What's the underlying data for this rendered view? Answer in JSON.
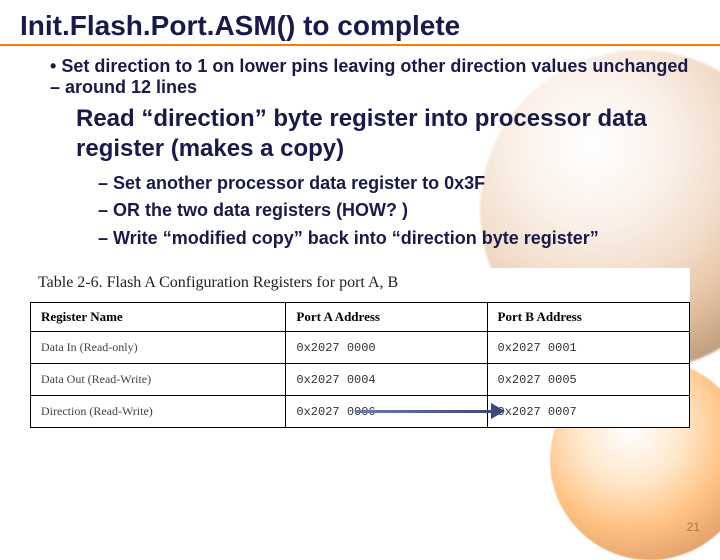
{
  "title": "Init.Flash.Port.ASM() to complete",
  "bullet1": "Set direction to 1 on lower pins leaving other direction values unchanged – around 12 lines",
  "subhead": "Read  “direction” byte register into processor data register (makes a copy)",
  "dashes": [
    "Set another processor data register to 0x3F",
    "OR the two data registers (HOW? )",
    "Write “modified copy” back into “direction byte register”"
  ],
  "figure": {
    "caption": "Table 2-6. Flash A Configuration Registers for port A, B",
    "headers": [
      "Register Name",
      "Port A Address",
      "Port B Address"
    ],
    "rows": [
      {
        "name": "Data In (Read-only)",
        "a": "0x2027 0000",
        "b": "0x2027 0001"
      },
      {
        "name": "Data Out (Read-Write)",
        "a": "0x2027 0004",
        "b": "0x2027 0005"
      },
      {
        "name": "Direction (Read-Write)",
        "a": "0x2027 0006",
        "b": "0x2027 0007"
      }
    ]
  },
  "pagenum": "21"
}
